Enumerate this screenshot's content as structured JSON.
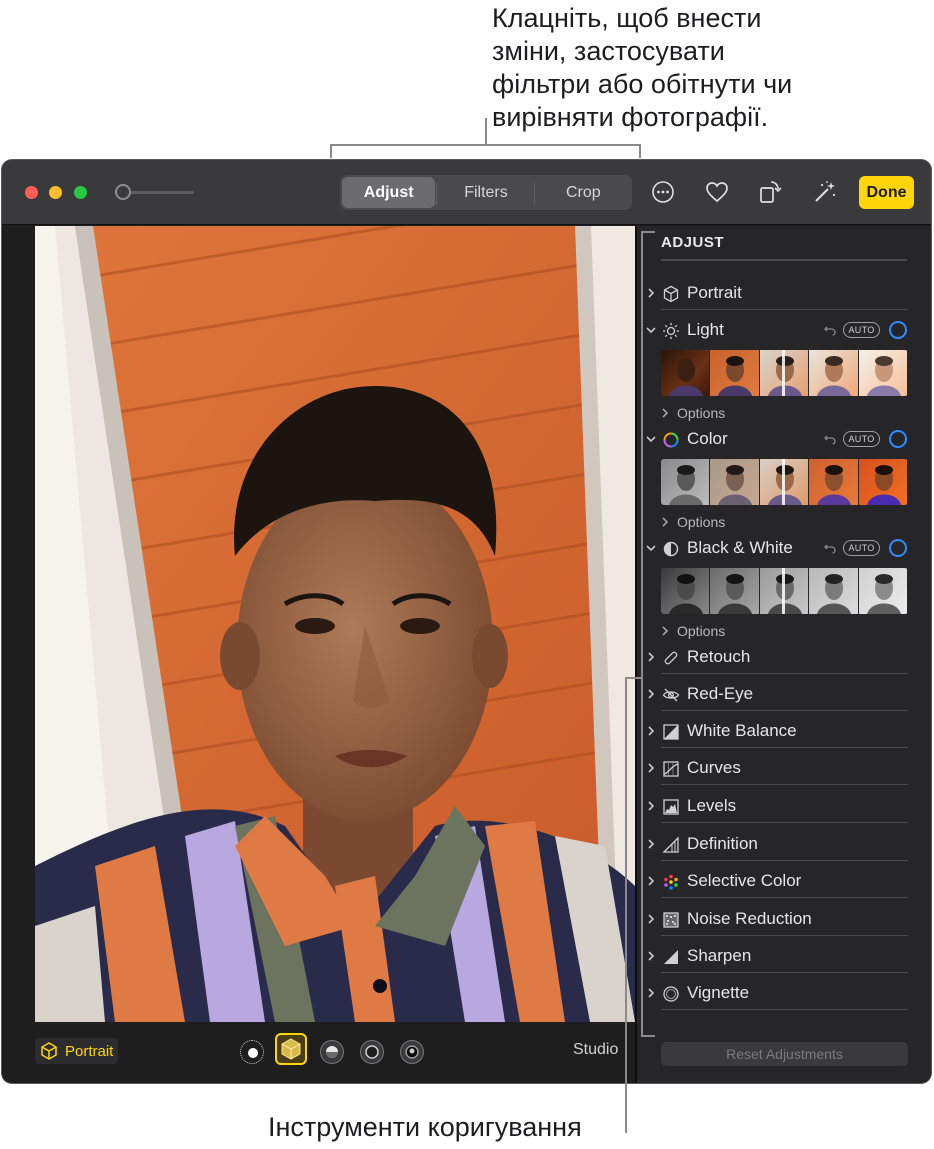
{
  "callouts": {
    "top_line1": "Клацніть, щоб внести",
    "top_line2": "зміни, застосувати",
    "top_line3": "фільтри або обітнути чи",
    "top_line4": "вирівняти фотографії.",
    "bottom": "Інструменти коригування"
  },
  "toolbar": {
    "tabs": [
      {
        "label": "Adjust",
        "active": true
      },
      {
        "label": "Filters",
        "active": false
      },
      {
        "label": "Crop",
        "active": false
      }
    ],
    "icons": [
      "more-icon",
      "heart-icon",
      "rotate-icon",
      "magic-wand-icon"
    ],
    "done_label": "Done",
    "accent": "#ffd60a"
  },
  "bottom_bar": {
    "portrait_label": "Portrait",
    "lighting_label": "Studio"
  },
  "panel": {
    "title": "ADJUST",
    "portrait": "Portrait",
    "light": "Light",
    "color": "Color",
    "bw": "Black & White",
    "options": "Options",
    "auto": "AUTO",
    "tools": [
      "Retouch",
      "Red-Eye",
      "White Balance",
      "Curves",
      "Levels",
      "Definition",
      "Selective Color",
      "Noise Reduction",
      "Sharpen",
      "Vignette"
    ],
    "reset": "Reset Adjustments",
    "toggle_color": "#2f8cff"
  }
}
